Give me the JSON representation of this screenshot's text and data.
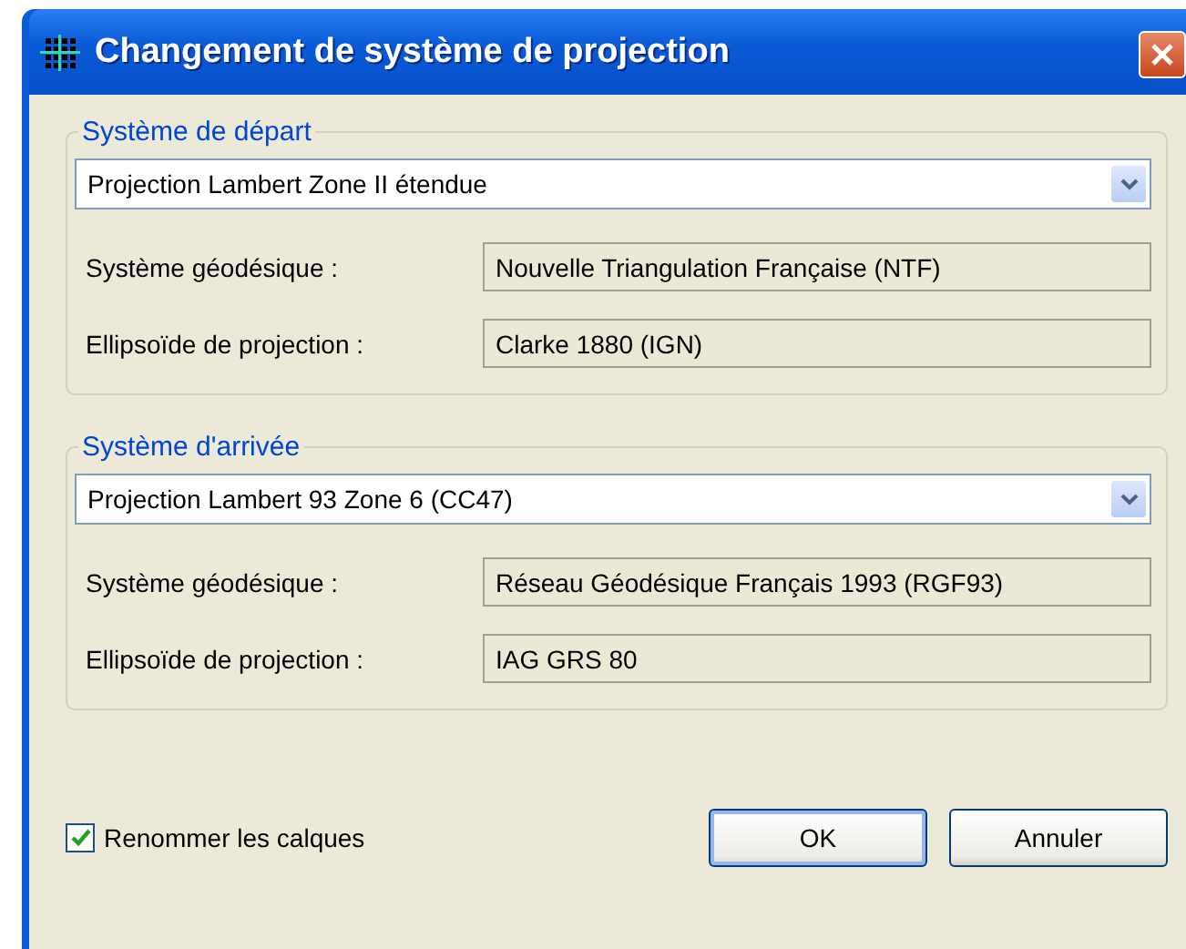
{
  "window": {
    "title": "Changement de système de projection"
  },
  "groups": [
    {
      "legend": "Système de départ",
      "combo": "Projection Lambert Zone II étendue",
      "rows": [
        {
          "label": "Système géodésique :",
          "value": "Nouvelle Triangulation Française (NTF)"
        },
        {
          "label": "Ellipsoïde de projection :",
          "value": "Clarke 1880 (IGN)"
        }
      ]
    },
    {
      "legend": "Système d'arrivée",
      "combo": "Projection Lambert 93 Zone 6 (CC47)",
      "rows": [
        {
          "label": "Système géodésique :",
          "value": "Réseau Géodésique Français 1993 (RGF93)"
        },
        {
          "label": "Ellipsoïde de projection :",
          "value": "IAG GRS 80"
        }
      ]
    }
  ],
  "rename_layers": {
    "label": "Renommer les calques",
    "checked": true
  },
  "buttons": [
    {
      "label": "OK",
      "default": true
    },
    {
      "label": "Annuler",
      "default": false
    }
  ]
}
